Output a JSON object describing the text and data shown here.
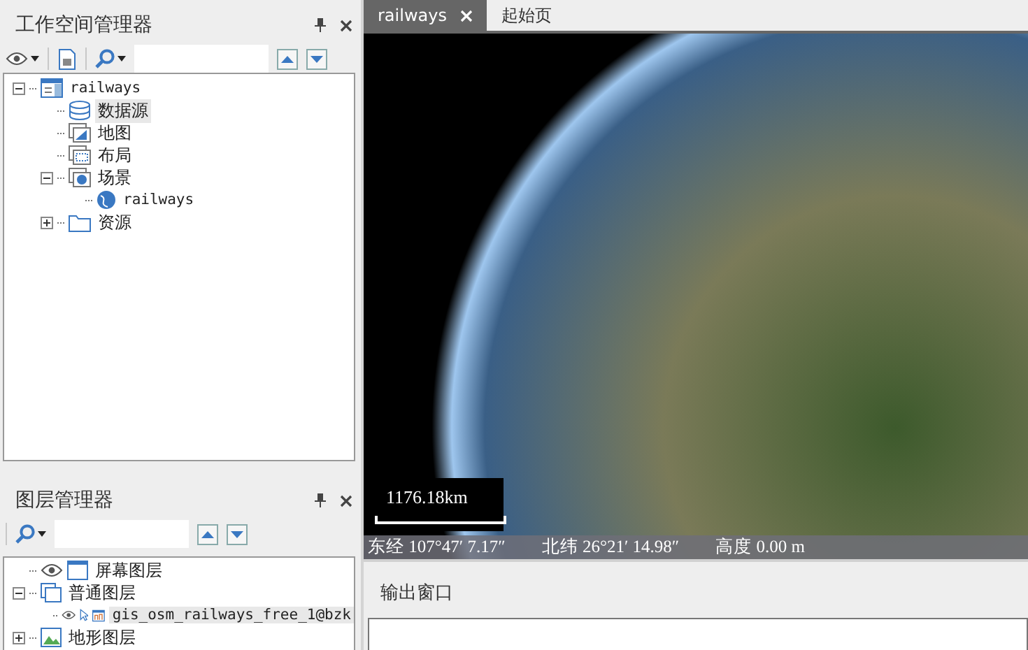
{
  "workspace_manager": {
    "title": "工作空间管理器",
    "tree": [
      {
        "label": "railways",
        "kind": "workspace",
        "expanded": true,
        "selected": false,
        "children": [
          {
            "label": "数据源",
            "kind": "datasource",
            "selected": true
          },
          {
            "label": "地图",
            "kind": "map",
            "selected": false
          },
          {
            "label": "布局",
            "kind": "layout",
            "selected": false
          },
          {
            "label": "场景",
            "kind": "scene",
            "expanded": true,
            "selected": false,
            "children": [
              {
                "label": "railways",
                "kind": "globe",
                "selected": false
              }
            ]
          },
          {
            "label": "资源",
            "kind": "folder",
            "expanded": false,
            "selected": false
          }
        ]
      }
    ]
  },
  "layer_manager": {
    "title": "图层管理器",
    "tree": [
      {
        "label": "屏幕图层",
        "kind": "screen",
        "selected": false
      },
      {
        "label": "普通图层",
        "kind": "group",
        "expanded": true,
        "selected": false,
        "children": [
          {
            "label": "gis_osm_railways_free_1@bzk",
            "kind": "line-layer",
            "selected": true
          }
        ]
      },
      {
        "label": "地形图层",
        "kind": "terrain",
        "expanded": false,
        "selected": false
      }
    ]
  },
  "tabs": [
    {
      "label": "railways",
      "selected": true
    },
    {
      "label": "起始页",
      "selected": false
    }
  ],
  "scene": {
    "scale": "1176.18km",
    "status": [
      "东经 107°47′ 7.17″",
      "北纬 26°21′ 14.98″",
      "高度 0.00 m"
    ]
  },
  "output_window": {
    "title": "输出窗口"
  }
}
